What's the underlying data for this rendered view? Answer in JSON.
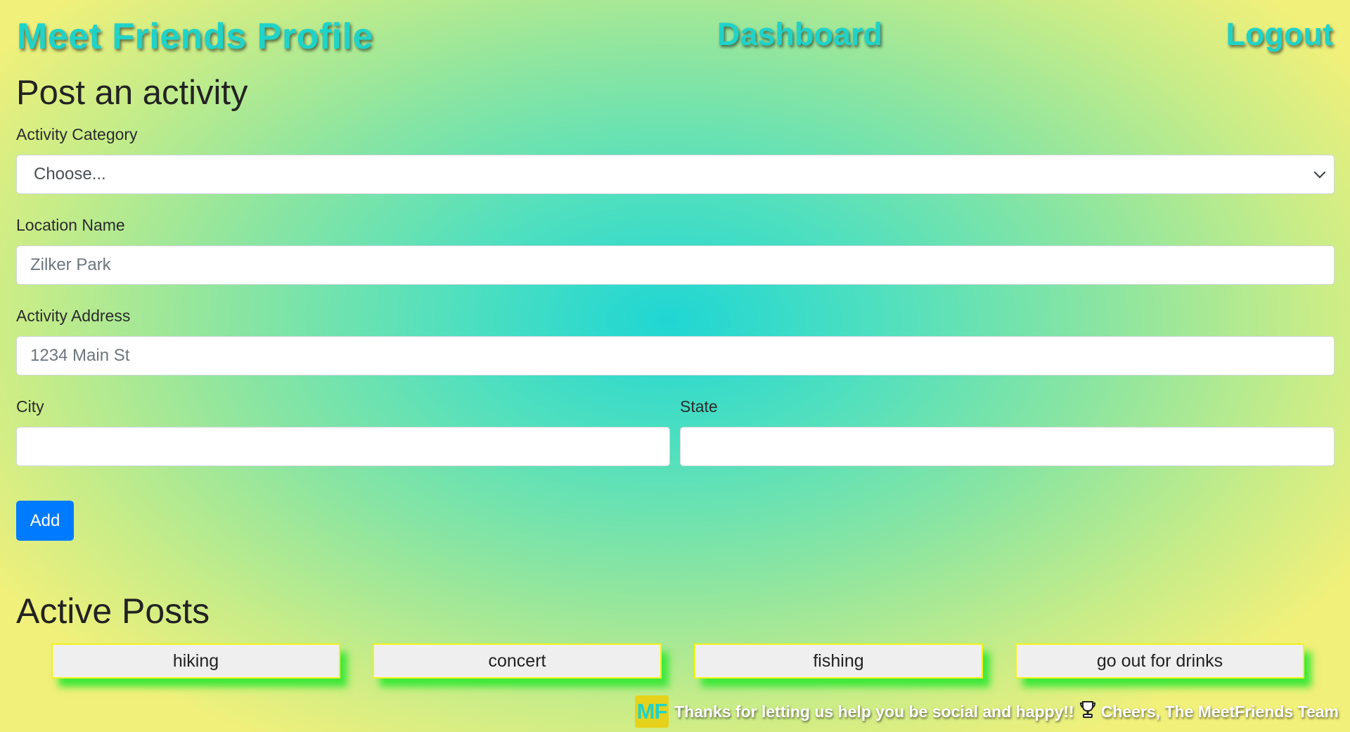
{
  "header": {
    "site_title": "Meet Friends Profile",
    "nav": {
      "dashboard": "Dashboard",
      "logout": "Logout"
    }
  },
  "form": {
    "heading": "Post an activity",
    "category": {
      "label": "Activity Category",
      "selected": "Choose..."
    },
    "location": {
      "label": "Location Name",
      "placeholder": "Zilker Park",
      "value": ""
    },
    "address": {
      "label": "Activity Address",
      "placeholder": "1234 Main St",
      "value": ""
    },
    "city": {
      "label": "City",
      "value": ""
    },
    "state": {
      "label": "State",
      "value": ""
    },
    "submit_label": "Add"
  },
  "active_posts": {
    "heading": "Active Posts",
    "items": [
      {
        "label": "hiking"
      },
      {
        "label": "concert"
      },
      {
        "label": "fishing"
      },
      {
        "label": "go out for drinks"
      }
    ]
  },
  "footer": {
    "logo_text": "MF",
    "message": "Thanks for letting us help you be social and happy!!",
    "trophy_icon": "trophy-icon",
    "signoff": "Cheers, The MeetFriends Team"
  },
  "colors": {
    "accent_title": "#1fd3c9",
    "button_primary": "#007bff",
    "card_border": "#f2f21c",
    "card_shadow": "#3ee83a",
    "logo_bg": "#e6d21a"
  }
}
